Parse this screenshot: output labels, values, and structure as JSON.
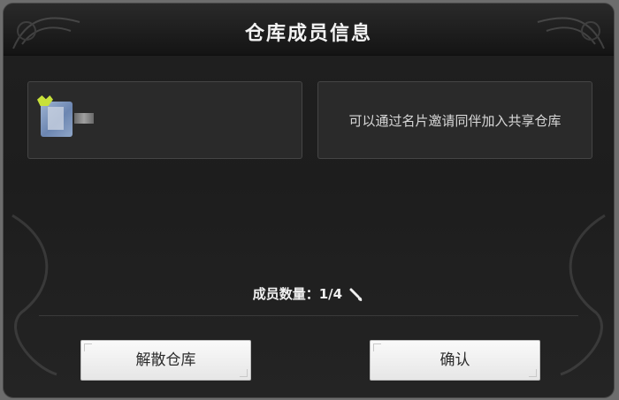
{
  "dialog": {
    "title": "仓库成员信息"
  },
  "members_panel": {
    "member_name": "",
    "icons": [
      "avatar-icon",
      "crown-badge-icon"
    ]
  },
  "invite_panel": {
    "text": "可以通过名片邀请同伴加入共享仓库"
  },
  "member_count": {
    "label": "成员数量：",
    "value": "1/4",
    "icon": "edit-brush-icon"
  },
  "buttons": {
    "dissolve_label": "解散仓库",
    "confirm_label": "确认"
  },
  "colors": {
    "background": "#1f1f1f",
    "header": "#151515",
    "panel": "#2a2a2a",
    "button": "#f2f2f2",
    "title_text": "#f3f3f3"
  }
}
